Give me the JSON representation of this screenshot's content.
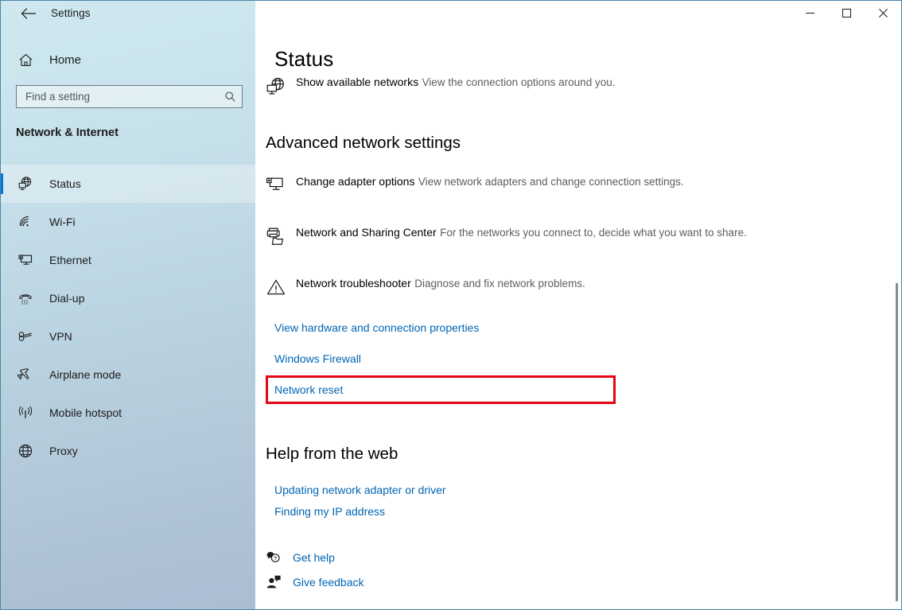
{
  "window": {
    "title": "Settings",
    "back_label": "back-arrow",
    "controls": {
      "minimize": "minimize",
      "maximize": "maximize",
      "close": "close"
    }
  },
  "sidebar": {
    "home_label": "Home",
    "search": {
      "placeholder": "Find a setting",
      "value": ""
    },
    "category": "Network & Internet",
    "items": [
      {
        "label": "Status",
        "icon": "network-status-icon",
        "selected": true
      },
      {
        "label": "Wi-Fi",
        "icon": "wifi-icon",
        "selected": false
      },
      {
        "label": "Ethernet",
        "icon": "ethernet-icon",
        "selected": false
      },
      {
        "label": "Dial-up",
        "icon": "dialup-phone-icon",
        "selected": false
      },
      {
        "label": "VPN",
        "icon": "vpn-key-icon",
        "selected": false
      },
      {
        "label": "Airplane mode",
        "icon": "airplane-icon",
        "selected": false
      },
      {
        "label": "Mobile hotspot",
        "icon": "hotspot-icon",
        "selected": false
      },
      {
        "label": "Proxy",
        "icon": "globe-icon",
        "selected": false
      }
    ]
  },
  "main": {
    "page_title": "Status",
    "show_networks": {
      "title": "Show available networks",
      "subtitle": "View the connection options around you.",
      "icon": "network-globe-monitor-icon"
    },
    "advanced_heading": "Advanced network settings",
    "advanced_items": [
      {
        "title": "Change adapter options",
        "subtitle": "View network adapters and change connection settings.",
        "icon": "monitor-adapter-icon"
      },
      {
        "title": "Network and Sharing Center",
        "subtitle": "For the networks you connect to, decide what you want to share.",
        "icon": "sharing-center-icon"
      },
      {
        "title": "Network troubleshooter",
        "subtitle": "Diagnose and fix network problems.",
        "icon": "warning-triangle-icon"
      }
    ],
    "links": [
      {
        "label": "View hardware and connection properties",
        "highlighted": false
      },
      {
        "label": "Windows Firewall",
        "highlighted": false
      },
      {
        "label": "Network reset",
        "highlighted": true
      }
    ],
    "help_heading": "Help from the web",
    "help_links": [
      "Updating network adapter or driver",
      "Finding my IP address"
    ],
    "footer_links": [
      {
        "label": "Get help",
        "icon": "help-bubble-icon"
      },
      {
        "label": "Give feedback",
        "icon": "feedback-person-icon"
      }
    ]
  },
  "colors": {
    "accent": "#0078d7",
    "link": "#0065b3",
    "highlight": "#e30613",
    "title_bar_border": "#4a88a8"
  }
}
